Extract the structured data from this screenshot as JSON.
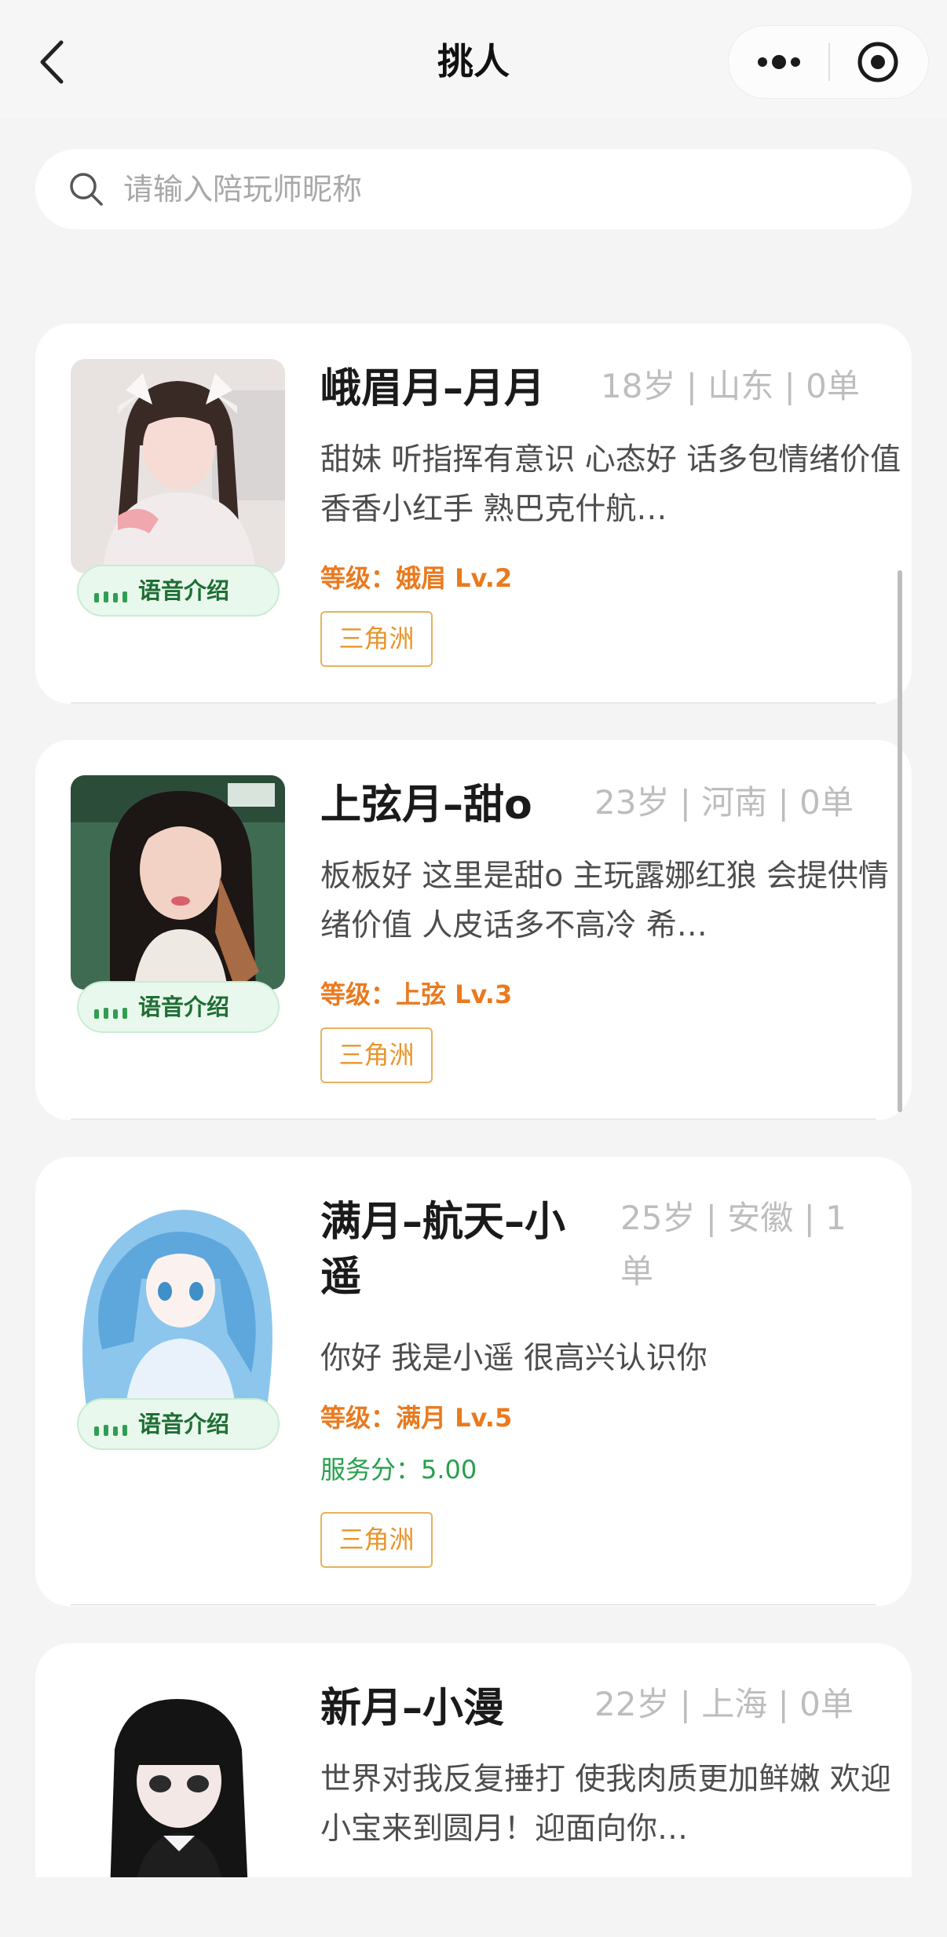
{
  "header": {
    "title": "挑人"
  },
  "search": {
    "placeholder": "请输入陪玩师昵称"
  },
  "companions": [
    {
      "name": "峨眉月–月月",
      "meta": "18岁 | 山东 | 0单",
      "description": "甜妹 听指挥有意识 心态好 话多包情绪价值 香香小红手 熟巴克什航…",
      "level": "等级：娥眉 Lv.2",
      "tag": "三角洲",
      "voice_label": "语音介绍"
    },
    {
      "name": "上弦月–甜o",
      "meta": "23岁 | 河南 | 0单",
      "description": "板板好 这里是甜o 主玩露娜红狼 会提供情绪价值 人皮话多不高冷 希…",
      "level": "等级：上弦 Lv.3",
      "tag": "三角洲",
      "voice_label": "语音介绍"
    },
    {
      "name_line1": "满月–航天–小",
      "name_line2": "遥",
      "meta_line1": "25岁 | 安徽 | 1",
      "meta_line2": "单",
      "description": "你好 我是小遥 很高兴认识你",
      "level": "等级：满月 Lv.5",
      "score": "服务分：5.00",
      "tag": "三角洲",
      "voice_label": "语音介绍"
    },
    {
      "name": "新月–小漫",
      "meta": "22岁 | 上海 | 0单",
      "description": "世界对我反复捶打 使我肉质更加鲜嫩 欢迎小宝来到圆月！迎面向你…"
    }
  ]
}
